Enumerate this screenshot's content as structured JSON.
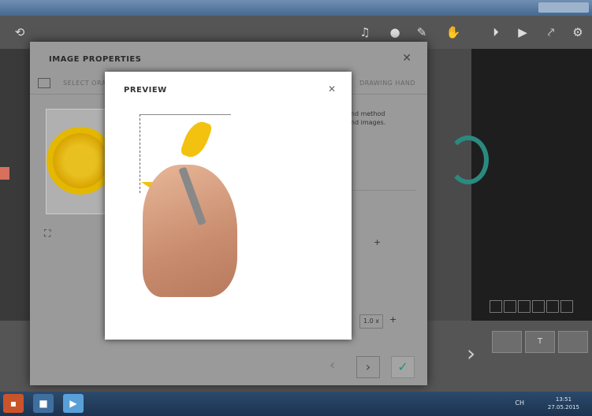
{
  "window": {
    "title": ""
  },
  "toolbar": {
    "icons": [
      "music-icon",
      "mic-icon",
      "pen-icon",
      "hand-icon",
      "play-from-icon",
      "play-icon",
      "share-icon",
      "settings-icon"
    ]
  },
  "dialog": {
    "title": "IMAGE PROPERTIES",
    "close_glyph": "✕",
    "tabs": [
      "SELECT ORA...",
      "DRAWING HAND"
    ],
    "side_text_line1": "and method",
    "side_text_line2": "and images.",
    "zoom_value": "1.0 x",
    "plus": "+",
    "prev_glyph": "‹",
    "next_glyph": "›",
    "ok_glyph": "✓"
  },
  "preview": {
    "title": "PREVIEW",
    "close_glyph": "✕"
  },
  "bottom": {
    "btn1": "",
    "btn2": "T",
    "btn3": ""
  },
  "taskbar": {
    "lang": "CH",
    "time": "13:51",
    "date": "27.05.2015"
  }
}
